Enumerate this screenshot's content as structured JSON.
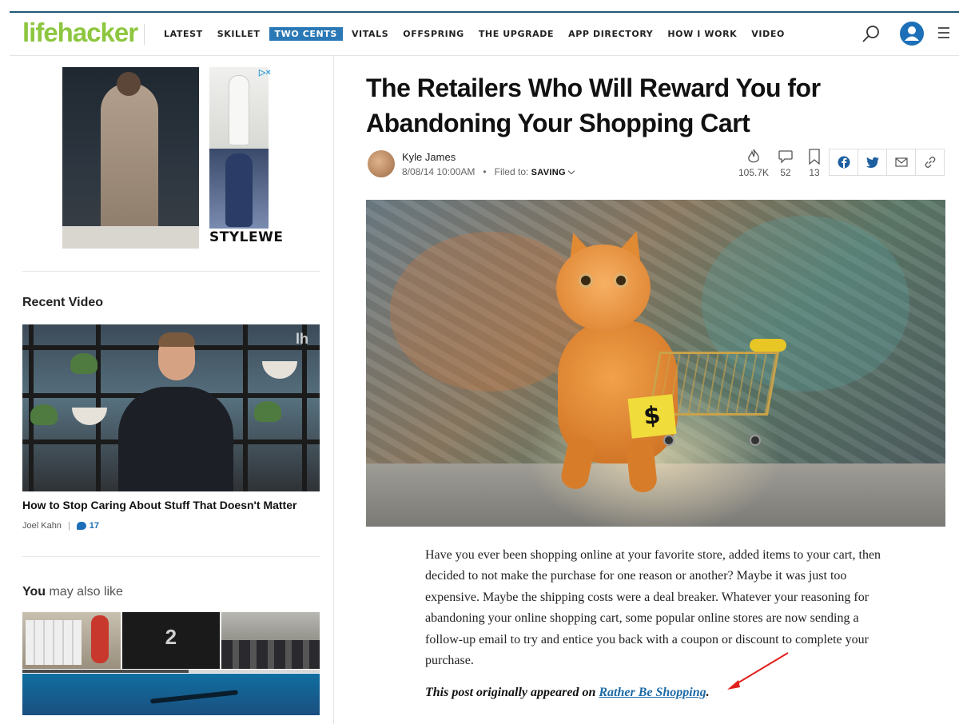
{
  "header": {
    "logo": "lifehacker",
    "nav": [
      "LATEST",
      "SKILLET",
      "TWO CENTS",
      "VITALS",
      "OFFSPRING",
      "THE UPGRADE",
      "APP DIRECTORY",
      "HOW I WORK",
      "VIDEO"
    ],
    "active_nav": "TWO CENTS",
    "icons": [
      "search-icon",
      "user-icon",
      "menu-icon"
    ],
    "accent_color": "#2a78b5",
    "logo_color": "#8dc63f"
  },
  "sidebar": {
    "ad_brand": "STYLEWE",
    "ad_choices": "▷×",
    "recent_video": {
      "heading": "Recent Video",
      "title": "How to Stop Caring About Stuff That Doesn't Matter",
      "author": "Joel Kahn",
      "separator": "|",
      "comments": "17",
      "logo_glyph": "lh"
    },
    "also_like": {
      "heading_bold": "You",
      "heading_light": " may also like",
      "tile2_label": "2"
    }
  },
  "article": {
    "headline": "The Retailers Who Will Reward You for Abandoning Your Shopping Cart",
    "author": "Kyle James",
    "date": "8/08/14 10:00AM",
    "filed_label": "Filed to:",
    "category": "SAVING",
    "stats": {
      "views": "105.7K",
      "comments": "52",
      "bookmarks": "13"
    },
    "share_icons": [
      "facebook-icon",
      "twitter-icon",
      "email-icon",
      "link-icon"
    ],
    "hero_tag": "$",
    "body": "Have you ever been shopping online at your favorite store, added items to your cart, then decided to not make the purchase for one reason or another? Maybe it was just too expensive. Maybe the shipping costs were a deal breaker. Whatever your reasoning for abandoning your online shopping cart, some popular online stores are now sending a follow-up email to try and entice you back with a coupon or discount to complete your purchase.",
    "credit_prefix": "This post originally appeared on ",
    "credit_link": "Rather Be Shopping",
    "credit_suffix": "."
  }
}
